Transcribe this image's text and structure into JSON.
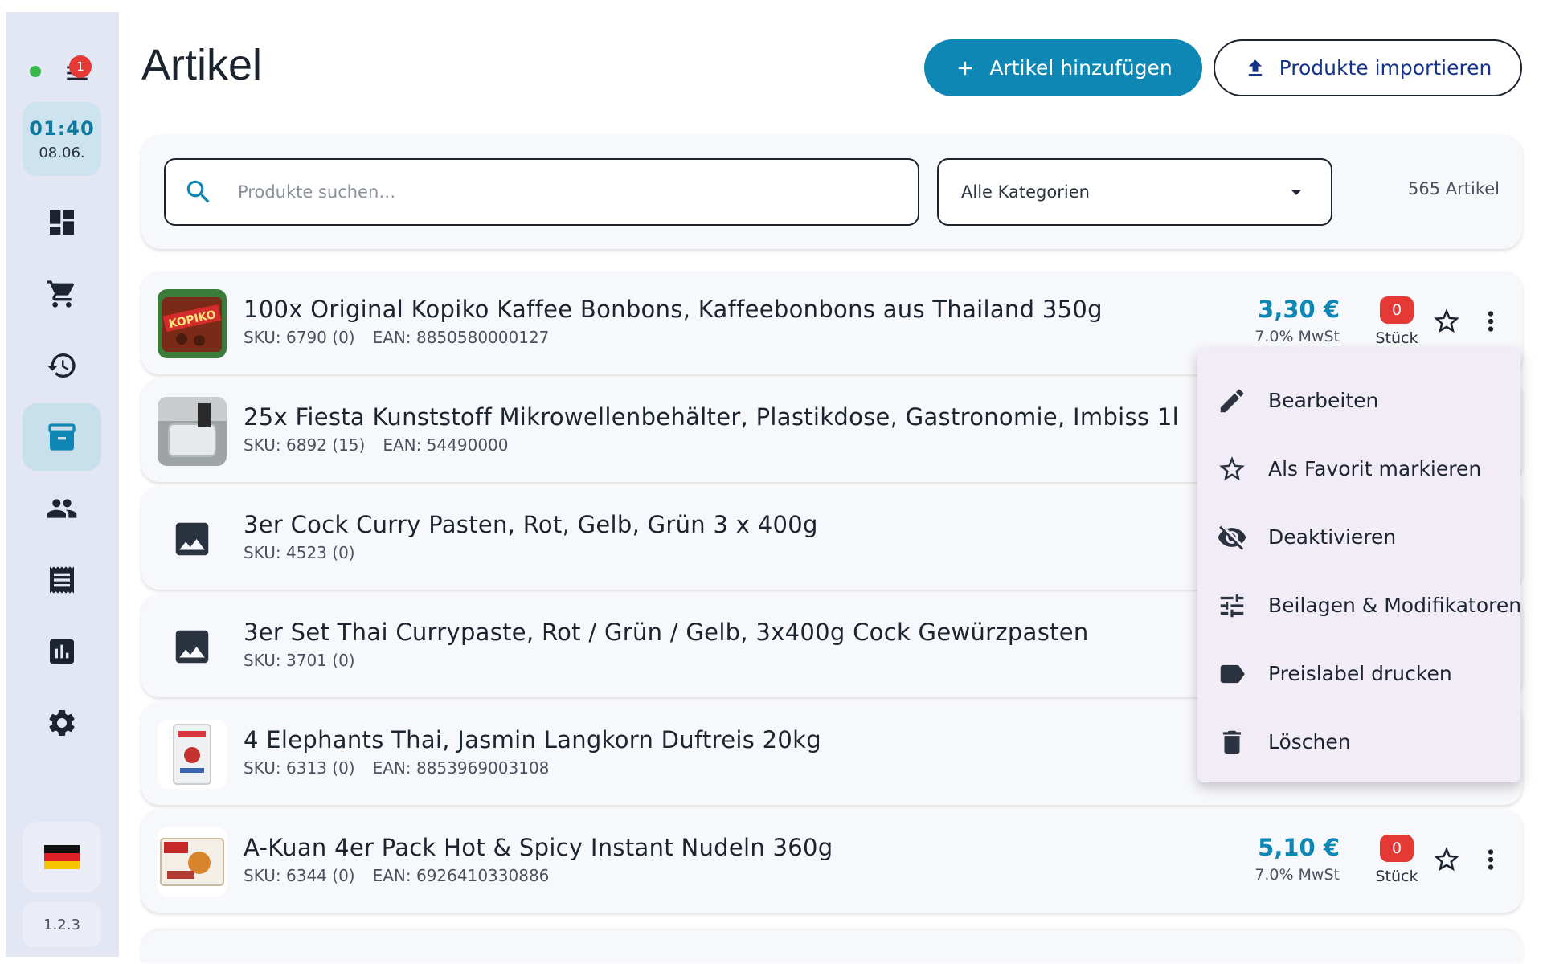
{
  "sidebar": {
    "notification_count": "1",
    "clock": {
      "time": "01:40",
      "date": "08.06."
    },
    "nav": [
      {
        "name": "dashboard",
        "icon": "dashboard-icon",
        "active": false
      },
      {
        "name": "cart",
        "icon": "cart-icon",
        "active": false
      },
      {
        "name": "history",
        "icon": "history-icon",
        "active": false
      },
      {
        "name": "articles",
        "icon": "archive-icon",
        "active": true
      },
      {
        "name": "customers",
        "icon": "people-icon",
        "active": false
      },
      {
        "name": "receipts",
        "icon": "receipt-icon",
        "active": false
      },
      {
        "name": "reports",
        "icon": "bar-chart-icon",
        "active": false
      },
      {
        "name": "settings",
        "icon": "gear-icon",
        "active": false
      }
    ],
    "language_flag": "de-flag-icon",
    "version": "1.2.3"
  },
  "header": {
    "title": "Artikel",
    "add_button": "Artikel hinzufügen",
    "import_button": "Produkte importieren"
  },
  "filters": {
    "search_placeholder": "Produkte suchen…",
    "category": "Alle Kategorien",
    "count": "565 Artikel"
  },
  "products": [
    {
      "name": "100x Original Kopiko Kaffee Bonbons, Kaffeebonbons aus Thailand 350g",
      "sku": "SKU: 6790 (0)",
      "ean": "EAN: 8850580000127",
      "price": "3,30 €",
      "vat": "7.0% MwSt",
      "stock": "0",
      "unit": "Stück",
      "image": "kopiko"
    },
    {
      "name": "25x Fiesta Kunststoff Mikrowellenbehälter, Plastikdose, Gastronomie, Imbiss 1l",
      "sku": "SKU: 6892 (15)",
      "ean": "EAN: 54490000",
      "image": "container"
    },
    {
      "name": "3er Cock Curry Pasten, Rot, Gelb, Grün 3 x 400g",
      "sku": "SKU: 4523 (0)",
      "ean": "",
      "image": "placeholder"
    },
    {
      "name": "3er Set Thai Currypaste, Rot / Grün / Gelb, 3x400g Cock Gewürzpasten",
      "sku": "SKU: 3701 (0)",
      "ean": "",
      "image": "placeholder"
    },
    {
      "name": "4 Elephants Thai, Jasmin Langkorn Duftreis 20kg",
      "sku": "SKU: 6313 (0)",
      "ean": "EAN: 8853969003108",
      "image": "rice"
    },
    {
      "name": "A-Kuan 4er Pack Hot & Spicy Instant Nudeln 360g",
      "sku": "SKU: 6344 (0)",
      "ean": "EAN: 6926410330886",
      "price": "5,10 €",
      "vat": "7.0% MwSt",
      "stock": "0",
      "unit": "Stück",
      "image": "noodles"
    }
  ],
  "context_menu": {
    "items": [
      {
        "label": "Bearbeiten",
        "icon": "pencil-icon"
      },
      {
        "label": "Als Favorit markieren",
        "icon": "star-outline-icon"
      },
      {
        "label": "Deaktivieren",
        "icon": "eye-off-icon"
      },
      {
        "label": "Beilagen & Modifikatoren",
        "icon": "tune-icon"
      },
      {
        "label": "Preislabel drucken",
        "icon": "label-icon"
      },
      {
        "label": "Löschen",
        "icon": "trash-icon"
      }
    ]
  },
  "colors": {
    "accent": "#0f87b4",
    "sidebar_bg": "#e3e6f3",
    "badge_red": "#e53935",
    "menu_bg": "#f1ecf6"
  }
}
